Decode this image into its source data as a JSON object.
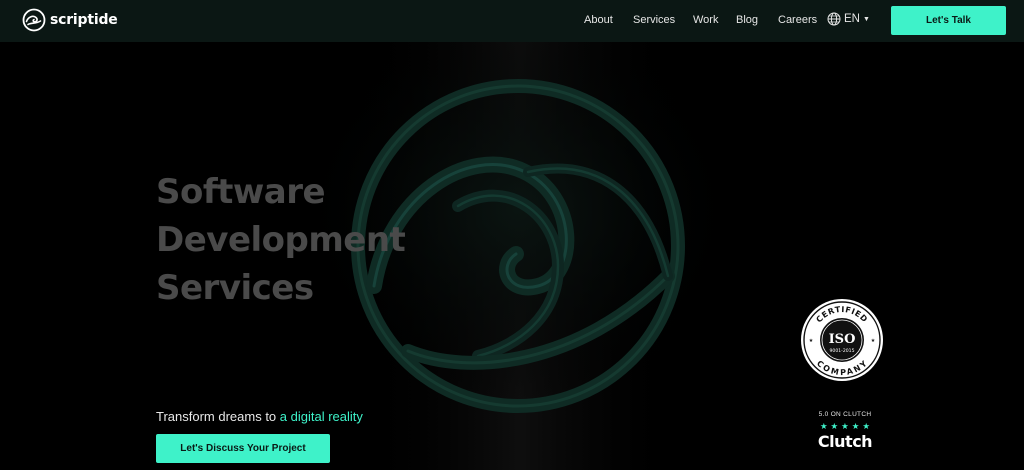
{
  "brand": {
    "name": "scriptide",
    "logo_icon": "wave-circle-icon"
  },
  "nav": {
    "links": [
      "About",
      "Services",
      "Work",
      "Blog",
      "Careers"
    ],
    "language": {
      "icon": "globe-icon",
      "label": "EN",
      "caret_icon": "caret-down-icon"
    },
    "cta_label": "Let's Talk"
  },
  "hero": {
    "title_lines": [
      "Software",
      "Development",
      "Services"
    ],
    "tagline_prefix": "Transform dreams to",
    "tagline_accent": "a digital reality",
    "cta_label": "Let's Discuss Your Project",
    "emblem_icon": "wave-emblem-icon"
  },
  "iso": {
    "top_text": "CERTIFIED",
    "main_text": "ISO",
    "sub_text": "9001-2015",
    "bottom_text": "COMPANY"
  },
  "clutch": {
    "rating_text": "5.0 ON CLUTCH",
    "stars": "★★★★★",
    "name": "Clutch"
  },
  "colors": {
    "accent": "#3ef2c9",
    "nav_bg": "#0b1714",
    "hero_bg": "#000000",
    "title_gray": "#4a4a4a"
  }
}
